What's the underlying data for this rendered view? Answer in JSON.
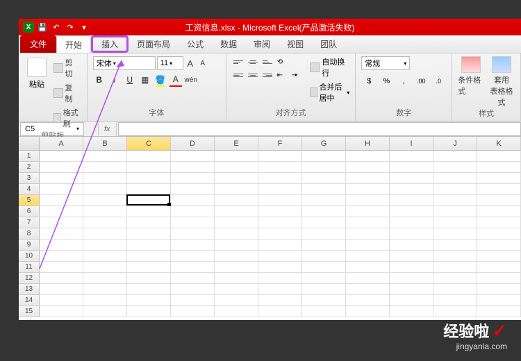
{
  "titlebar": {
    "title": "工资信息.xlsx - Microsoft Excel(产品激活失败)"
  },
  "tabs": {
    "file": "文件",
    "home": "开始",
    "insert": "插入",
    "layout": "页面布局",
    "formulas": "公式",
    "data": "数据",
    "review": "审阅",
    "view": "视图",
    "team": "团队"
  },
  "ribbon": {
    "clipboard": {
      "label": "剪贴板",
      "paste": "粘贴",
      "cut": "剪切",
      "copy": "复制",
      "format": "格式刷"
    },
    "font": {
      "label": "字体",
      "font_name": "宋体",
      "font_size": "11",
      "grow": "A",
      "shrink": "A"
    },
    "alignment": {
      "label": "对齐方式",
      "wrap": "自动换行",
      "merge": "合并后居中"
    },
    "number": {
      "label": "数字",
      "format": "常规"
    },
    "styles": {
      "label": "样式",
      "cond": "条件格式",
      "table": "套用\n表格格式"
    }
  },
  "formula_bar": {
    "name_box": "C5",
    "fx": "fx"
  },
  "columns": [
    "A",
    "B",
    "C",
    "D",
    "E",
    "F",
    "G",
    "H",
    "I",
    "J",
    "K"
  ],
  "rows": [
    "1",
    "2",
    "3",
    "4",
    "5",
    "6",
    "7",
    "8",
    "9",
    "10",
    "11",
    "12",
    "13",
    "14",
    "15"
  ],
  "active_cell": {
    "col": 2,
    "row": 4
  },
  "watermark": {
    "main": "经验啦",
    "sub": "jingyanla.com"
  }
}
